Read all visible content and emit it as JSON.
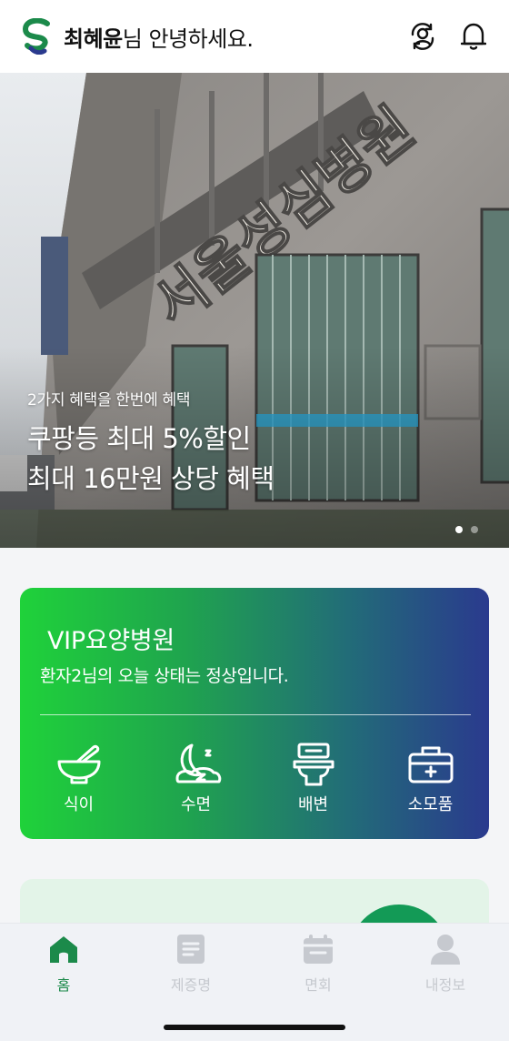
{
  "header": {
    "user_name": "최혜윤",
    "greeting_suffix": "님 안녕하세요.",
    "icons": [
      "app-logo-icon",
      "switch-user-icon",
      "bell-icon"
    ]
  },
  "banner": {
    "subtitle": "2가지 혜택을 한번에 혜택",
    "line1": "쿠팡등 최대 5%할인",
    "line2": "최대 16만원 상당 혜택",
    "photo_sign_text": "서울성심병원",
    "slide_count": 2,
    "active_slide": 1
  },
  "vip_card": {
    "title": "VIP요양병원",
    "status": "환자2님의 오늘 상태는 정상입니다.",
    "items": [
      {
        "label": "식이",
        "icon": "mortar-bowl-icon"
      },
      {
        "label": "수면",
        "icon": "moon-sleep-icon"
      },
      {
        "label": "배변",
        "icon": "toilet-icon"
      },
      {
        "label": "소모품",
        "icon": "medical-kit-icon"
      }
    ]
  },
  "tabbar": {
    "tabs": [
      {
        "label": "홈",
        "icon": "home-icon",
        "active": true
      },
      {
        "label": "제증명",
        "icon": "document-icon",
        "active": false
      },
      {
        "label": "면회",
        "icon": "calendar-icon",
        "active": false
      },
      {
        "label": "내정보",
        "icon": "person-icon",
        "active": false
      }
    ]
  },
  "colors": {
    "brand_green": "#1b8a4a",
    "card_gradient_start": "#1fd23a",
    "card_gradient_end": "#2a3a8e",
    "tab_inactive": "#c6c9cf"
  }
}
